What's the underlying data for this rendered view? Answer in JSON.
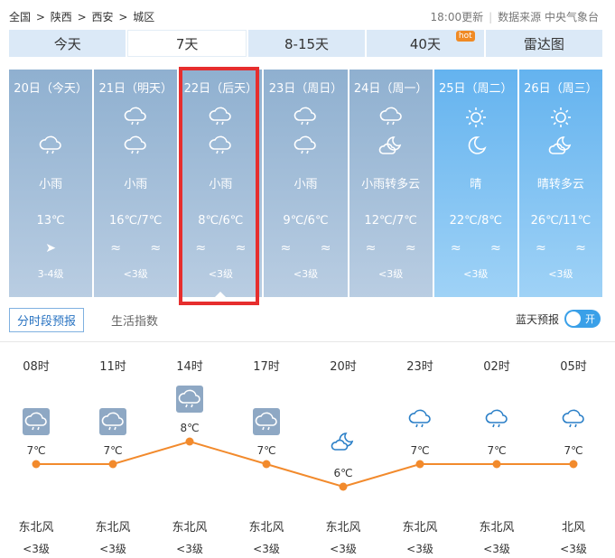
{
  "breadcrumb": [
    "全国",
    ">",
    "陕西",
    ">",
    "西安",
    ">",
    "城区"
  ],
  "update_time": "18:00更新",
  "source_label": "数据来源 中央气象台",
  "tabs": [
    {
      "label": "今天"
    },
    {
      "label": "7天",
      "active": true
    },
    {
      "label": "8-15天"
    },
    {
      "label": "40天",
      "badge": "hot"
    },
    {
      "label": "雷达图"
    }
  ],
  "days": [
    {
      "date": "20日（今天）",
      "icon_day": "",
      "icon_night": "cloud-rain-icon",
      "desc": "小雨",
      "temp": "13℃",
      "wind": "➤",
      "level": "3-4级",
      "style": "cloudy"
    },
    {
      "date": "21日（明天）",
      "icon_day": "cloud-rain-icon",
      "icon_night": "cloud-rain-icon",
      "desc": "小雨",
      "temp": "16℃/7℃",
      "wind": "≈ ≈",
      "level": "<3级",
      "style": "cloudy"
    },
    {
      "date": "22日（后天）",
      "icon_day": "cloud-rain-icon",
      "icon_night": "cloud-rain-icon",
      "desc": "小雨",
      "temp": "8℃/6℃",
      "wind": "≈ ≈",
      "level": "<3级",
      "style": "cloudy"
    },
    {
      "date": "23日（周日）",
      "icon_day": "cloud-rain-icon",
      "icon_night": "cloud-rain-icon",
      "desc": "小雨",
      "temp": "9℃/6℃",
      "wind": "≈ ≈",
      "level": "<3级",
      "style": "cloudy"
    },
    {
      "date": "24日（周一）",
      "icon_day": "cloud-rain-icon",
      "icon_night": "moon-cloud-icon",
      "desc": "小雨转多云",
      "temp": "12℃/7℃",
      "wind": "≈ ≈",
      "level": "<3级",
      "style": "cloudy"
    },
    {
      "date": "25日（周二）",
      "icon_day": "sun-icon",
      "icon_night": "moon-icon",
      "desc": "晴",
      "temp": "22℃/8℃",
      "wind": "≈ ≈",
      "level": "<3级",
      "style": "sunny"
    },
    {
      "date": "26日（周三）",
      "icon_day": "sun-icon",
      "icon_night": "moon-cloud-icon",
      "desc": "晴转多云",
      "temp": "26℃/11℃",
      "wind": "≈ ≈",
      "level": "<3级",
      "style": "sunny"
    }
  ],
  "subtabs": {
    "hourly": "分时段预报",
    "life": "生活指数"
  },
  "blue_sky": {
    "label": "蓝天预报",
    "toggle": "开"
  },
  "hourly": [
    {
      "time": "08时",
      "temp": "7℃",
      "temp_val": 7,
      "icon": "cloud-rain-box-icon",
      "wind": "东北风",
      "level": "<3级"
    },
    {
      "time": "11时",
      "temp": "7℃",
      "temp_val": 7,
      "icon": "cloud-rain-box-icon",
      "wind": "东北风",
      "level": "<3级"
    },
    {
      "time": "14时",
      "temp": "8℃",
      "temp_val": 8,
      "icon": "cloud-rain-box-icon",
      "wind": "东北风",
      "level": "<3级"
    },
    {
      "time": "17时",
      "temp": "7℃",
      "temp_val": 7,
      "icon": "cloud-rain-box-icon",
      "wind": "东北风",
      "level": "<3级"
    },
    {
      "time": "20时",
      "temp": "6℃",
      "temp_val": 6,
      "icon": "moon-cloud-icon",
      "wind": "东北风",
      "level": "<3级"
    },
    {
      "time": "23时",
      "temp": "7℃",
      "temp_val": 7,
      "icon": "cloud-rain-icon",
      "wind": "东北风",
      "level": "<3级"
    },
    {
      "time": "02时",
      "temp": "7℃",
      "temp_val": 7,
      "icon": "cloud-rain-icon",
      "wind": "东北风",
      "level": "<3级"
    },
    {
      "time": "05时",
      "temp": "7℃",
      "temp_val": 7,
      "icon": "cloud-rain-icon",
      "wind": "北风",
      "level": "<3级"
    }
  ],
  "colors": {
    "line": "#f28a2c",
    "accent": "#2a74c2",
    "highlight": "#e62e2e"
  }
}
